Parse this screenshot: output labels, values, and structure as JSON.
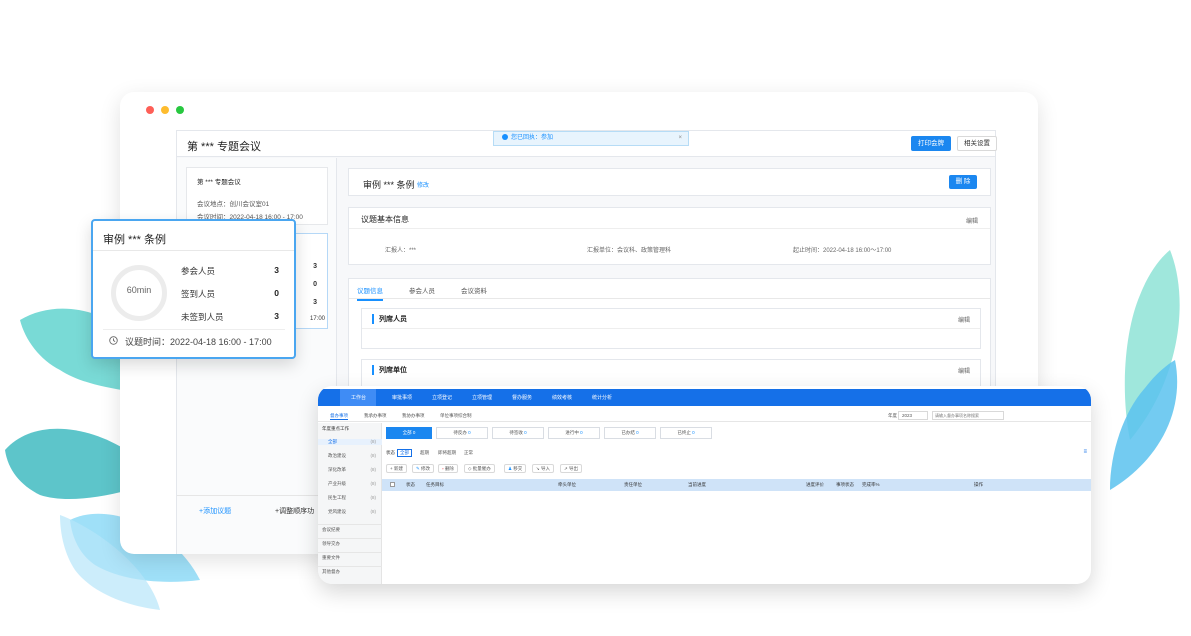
{
  "main_window": {
    "app_title": "第 *** 专题会议",
    "notice": "您已回执：参加",
    "notice_close": "×",
    "print_button": "打印会牌",
    "settings_button": "相关设置",
    "meeting_card": {
      "title": "第 *** 专题会议",
      "location": "会议地点：创川会议室01",
      "time": "会议时间：2022-04-18 16:00 - 17:00"
    },
    "left_counts": [
      "3",
      "0",
      "3"
    ],
    "left_time_fragment": "17:00",
    "add_topic": "+添加议题",
    "reorder": "+调整顺序功",
    "topic": {
      "title": "审例 *** 条例",
      "edit": "修改",
      "delete": "删 除"
    },
    "basic_info": {
      "title": "议题基本信息",
      "edit": "编辑",
      "reporter": "汇报人：***",
      "unit": "汇报单位：会议科、政策管理科",
      "time": "起止时间：2022-04-18 16:00～17:00"
    },
    "tabs": [
      "议题信息",
      "参会人员",
      "会议资料"
    ],
    "sections": [
      {
        "title": "列席人员",
        "edit": "编辑"
      },
      {
        "title": "列席单位",
        "edit": "编辑"
      }
    ]
  },
  "popup": {
    "title": "审例 *** 条例",
    "duration": "60min",
    "rows": [
      {
        "label": "参会人员",
        "value": "3"
      },
      {
        "label": "签到人员",
        "value": "0"
      },
      {
        "label": "未签到人员",
        "value": "3"
      }
    ],
    "time": "议题时间：2022-04-18 16:00 - 17:00"
  },
  "system": {
    "nav": [
      "工作台",
      "审批事项",
      "立项登记",
      "立项管理",
      "督办服务",
      "绩效考核",
      "统计分析"
    ],
    "subtabs": [
      "督办事项",
      "我承办事项",
      "我协办事项",
      "单位事项综合制"
    ],
    "year_label": "年度",
    "year_value": "2023",
    "search_placeholder": "请输入督办事项名称搜索",
    "sidebar": [
      {
        "label": "年度重点工作",
        "badge": ""
      },
      {
        "label": "全部",
        "badge": "(8)"
      },
      {
        "label": "政治建设",
        "badge": "(8)"
      },
      {
        "label": "深化改革",
        "badge": "(8)"
      },
      {
        "label": "产业升级",
        "badge": "(8)"
      },
      {
        "label": "民生工程",
        "badge": "(8)"
      },
      {
        "label": "党风建设",
        "badge": "(8)"
      },
      {
        "label": "会议纪要",
        "badge": ""
      },
      {
        "label": "领导交办",
        "badge": ""
      },
      {
        "label": "重要文件",
        "badge": ""
      },
      {
        "label": "其他督办",
        "badge": ""
      }
    ],
    "stats": [
      {
        "label": "全部",
        "value": "0"
      },
      {
        "label": "待反办",
        "value": "0"
      },
      {
        "label": "待签收",
        "value": "0"
      },
      {
        "label": "进行中",
        "value": "0"
      },
      {
        "label": "已办结",
        "value": "0"
      },
      {
        "label": "已终止",
        "value": "0"
      }
    ],
    "status_label": "状态",
    "status_filters": [
      "全部",
      "超期",
      "即将超期",
      "正常"
    ],
    "toolbar": [
      "新建",
      "修改",
      "删除",
      "批量催办",
      "移交",
      "导入",
      "导出"
    ],
    "columns": [
      "状态",
      "任务目标",
      "牵头单位",
      "责任单位",
      "当前进度",
      "进度评价",
      "事项状态",
      "完成率%",
      "操作"
    ]
  },
  "colors": {
    "accent": "#1b87f0",
    "nav": "#1570e8",
    "table_head": "#cfe3f8"
  }
}
